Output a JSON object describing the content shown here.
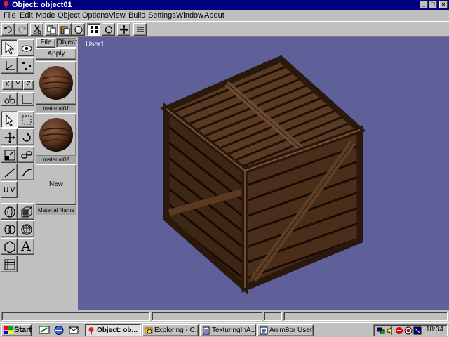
{
  "window": {
    "title": "Object: object01",
    "minimize_glyph": "_",
    "maximize_glyph": "□",
    "close_glyph": "×"
  },
  "menu": [
    "File",
    "Edit",
    "Mode",
    "Object",
    "Options",
    "View",
    "Build",
    "Settings",
    "Window",
    "About"
  ],
  "toolbar": {
    "icons": [
      "undo-icon",
      "redo-icon",
      "cut-icon",
      "copy-icon",
      "paste-icon",
      "material-sphere-icon",
      "grid-dots-icon",
      "rotate-view-icon",
      "move-view-icon",
      "list-icon"
    ]
  },
  "tools": {
    "axis_x": "X",
    "axis_y": "Y",
    "axis_z": "Z",
    "uv_label": "uv",
    "text_tool": "A"
  },
  "materials": {
    "tab_file": "File",
    "tab_object": "Object",
    "apply_label": "Apply",
    "items": [
      {
        "name": "material01"
      },
      {
        "name": "material02"
      }
    ],
    "new_label": "New",
    "name_label": "Material Name"
  },
  "viewport": {
    "label": "User1",
    "background": "#5f5f99"
  },
  "taskbar": {
    "start_label": "Start",
    "tasks": [
      {
        "label": "Object: ob...",
        "active": true
      },
      {
        "label": "Exploring - C...",
        "active": false
      },
      {
        "label": "TexturingInA...",
        "active": false
      },
      {
        "label": "Anim8or User'...",
        "active": false
      }
    ],
    "clock": "18:34"
  },
  "colors": {
    "titlebar": "#000080",
    "face": "#c0c0c0",
    "wood_dark": "#3a2414",
    "wood_light": "#6b4a30"
  }
}
